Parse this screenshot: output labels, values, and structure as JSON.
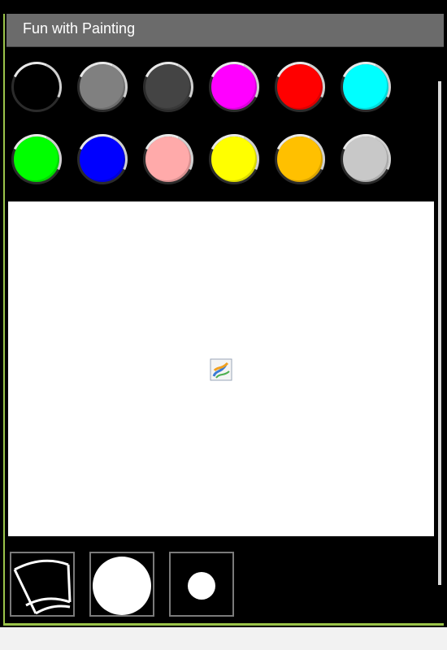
{
  "window": {
    "title": "Fun with Painting"
  },
  "palette": {
    "colors": [
      {
        "name": "black",
        "hex": "#000000"
      },
      {
        "name": "gray",
        "hex": "#808080"
      },
      {
        "name": "dark-gray",
        "hex": "#444444"
      },
      {
        "name": "magenta",
        "hex": "#ff00ff"
      },
      {
        "name": "red",
        "hex": "#ff0000"
      },
      {
        "name": "cyan",
        "hex": "#00ffff"
      },
      {
        "name": "green",
        "hex": "#00ff00"
      },
      {
        "name": "blue",
        "hex": "#0000ff"
      },
      {
        "name": "pink",
        "hex": "#ffaaaa"
      },
      {
        "name": "yellow",
        "hex": "#ffff00"
      },
      {
        "name": "orange",
        "hex": "#ffc000"
      },
      {
        "name": "light-gray",
        "hex": "#c8c8c8"
      }
    ]
  },
  "canvas": {
    "placeholder_icon": "broken-image-icon"
  },
  "tools": [
    {
      "name": "brush-tool",
      "icon": "fan-brush-icon"
    },
    {
      "name": "large-brush-size",
      "icon": "large-circle-icon"
    },
    {
      "name": "small-brush-size",
      "icon": "small-circle-icon"
    }
  ]
}
